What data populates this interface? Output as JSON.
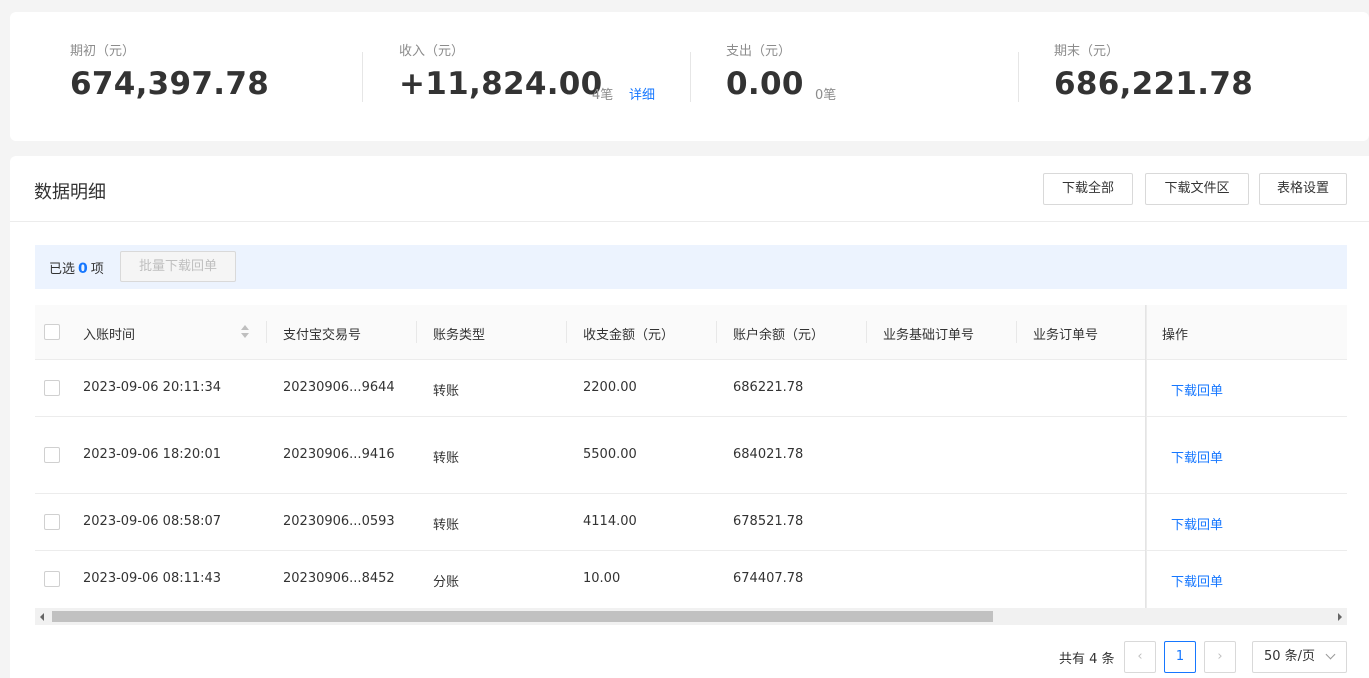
{
  "summary": {
    "opening": {
      "label": "期初（元）",
      "value": "674,397.78"
    },
    "income": {
      "label": "收入（元）",
      "value": "+11,824.00",
      "count": "4笔",
      "detail": "详细"
    },
    "expense": {
      "label": "支出（元）",
      "value": "0.00",
      "count": "0笔"
    },
    "closing": {
      "label": "期末（元）",
      "value": "686,221.78"
    }
  },
  "panel": {
    "title": "数据明细",
    "buttons": {
      "download_all": "下载全部",
      "download_area": "下载文件区",
      "table_settings": "表格设置"
    }
  },
  "selection": {
    "prefix": "已选",
    "count": "0",
    "suffix": "项",
    "batch_button": "批量下载回单"
  },
  "table": {
    "columns": [
      "入账时间",
      "支付宝交易号",
      "账务类型",
      "收支金额（元）",
      "账户余额（元）",
      "业务基础订单号",
      "业务订单号",
      "操作"
    ],
    "rows": [
      {
        "time": "2023-09-06 20:11:34",
        "trade_no": "20230906...9644",
        "type": "转账",
        "amount": "2200.00",
        "balance": "686221.78",
        "base_order": "",
        "order": "",
        "action": "下载回单"
      },
      {
        "time": "2023-09-06 18:20:01",
        "trade_no": "20230906...9416",
        "type": "转账",
        "amount": "5500.00",
        "balance": "684021.78",
        "base_order": "",
        "order": "",
        "action": "下载回单"
      },
      {
        "time": "2023-09-06 08:58:07",
        "trade_no": "20230906...0593",
        "type": "转账",
        "amount": "4114.00",
        "balance": "678521.78",
        "base_order": "",
        "order": "",
        "action": "下载回单"
      },
      {
        "time": "2023-09-06 08:11:43",
        "trade_no": "20230906...8452",
        "type": "分账",
        "amount": "10.00",
        "balance": "674407.78",
        "base_order": "",
        "order": "",
        "action": "下载回单"
      }
    ]
  },
  "pagination": {
    "total": "共有 4 条",
    "current": "1",
    "prev": "‹",
    "next": "›",
    "page_size": "50 条/页"
  },
  "colors": {
    "accent": "#1677ff",
    "selbar_bg": "#ecf3fe"
  }
}
